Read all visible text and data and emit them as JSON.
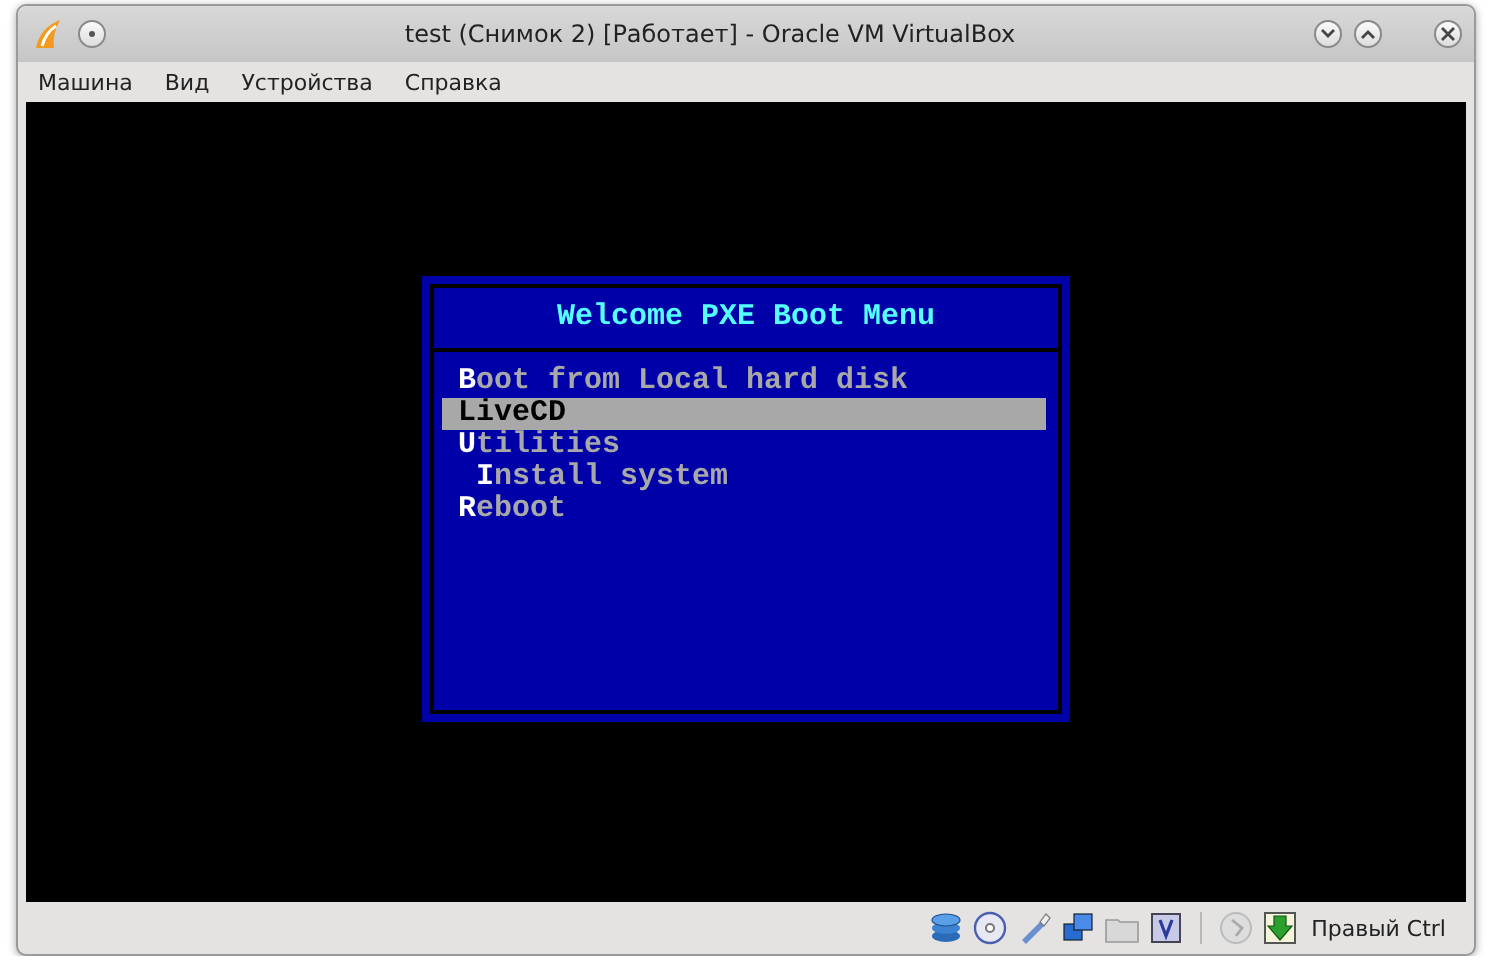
{
  "window": {
    "title": "test (Снимок 2) [Работает] - Oracle VM VirtualBox"
  },
  "menu_bar": [
    "Машина",
    "Вид",
    "Устройства",
    "Справка"
  ],
  "boot_menu": {
    "title": "Welcome PXE Boot Menu",
    "items": [
      {
        "label": "Boot from Local hard disk",
        "selected": false
      },
      {
        "label": "LiveCD",
        "selected": true
      },
      {
        "label": "Utilities",
        "selected": false
      },
      {
        "label": " Install system",
        "selected": false
      },
      {
        "label": "Reboot",
        "selected": false
      }
    ]
  },
  "status_bar": {
    "host_key": "Правый Ctrl"
  }
}
